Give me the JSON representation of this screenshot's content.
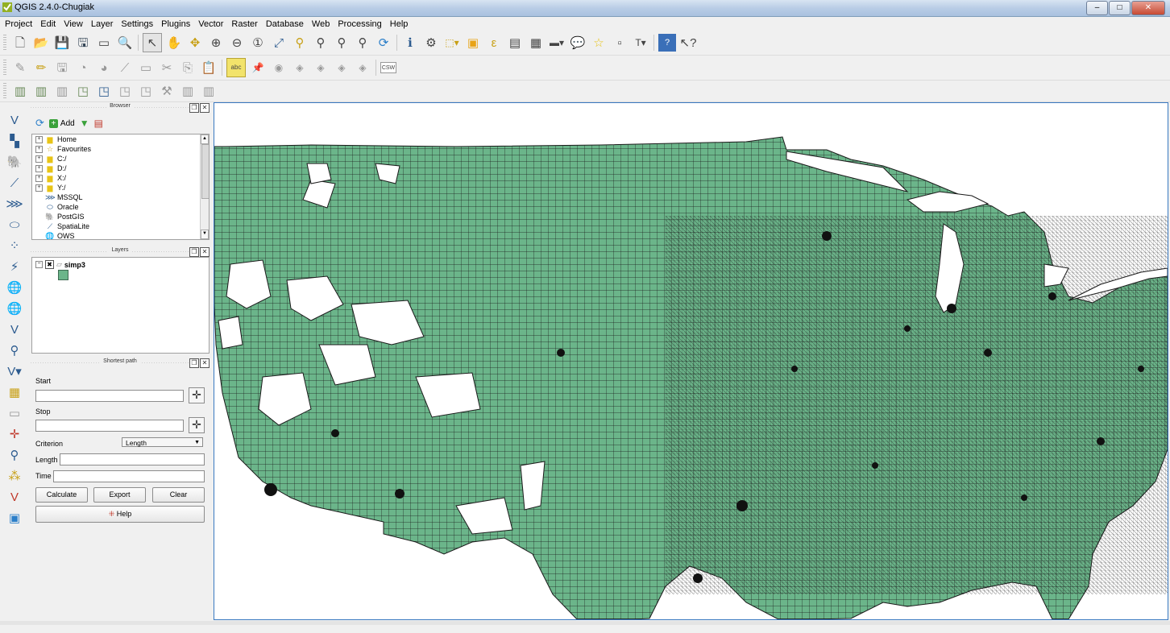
{
  "window": {
    "title": "QGIS 2.4.0-Chugiak"
  },
  "menu": [
    "Project",
    "Edit",
    "View",
    "Layer",
    "Settings",
    "Plugins",
    "Vector",
    "Raster",
    "Database",
    "Web",
    "Processing",
    "Help"
  ],
  "toolbar": {
    "label_abc": "abc",
    "csw": "CSW",
    "help_label": "?"
  },
  "browser": {
    "title": "Browser",
    "add_label": "Add",
    "items": [
      {
        "label": "Home",
        "icon": "folder-icon",
        "expandable": true
      },
      {
        "label": "Favourites",
        "icon": "star-icon",
        "expandable": true
      },
      {
        "label": "C:/",
        "icon": "folder-icon",
        "expandable": true
      },
      {
        "label": "D:/",
        "icon": "folder-icon",
        "expandable": true
      },
      {
        "label": "X:/",
        "icon": "folder-icon",
        "expandable": true
      },
      {
        "label": "Y:/",
        "icon": "folder-icon",
        "expandable": true
      },
      {
        "label": "MSSQL",
        "icon": "mssql-icon",
        "expandable": false
      },
      {
        "label": "Oracle",
        "icon": "oracle-icon",
        "expandable": false
      },
      {
        "label": "PostGIS",
        "icon": "postgis-icon",
        "expandable": false
      },
      {
        "label": "SpatiaLite",
        "icon": "spatialite-icon",
        "expandable": false
      },
      {
        "label": "OWS",
        "icon": "ows-icon",
        "expandable": false
      }
    ]
  },
  "layers": {
    "title": "Layers",
    "layer_name": "simp3",
    "fill_color": "#6bb58a"
  },
  "shortest_path": {
    "title": "Shortest path",
    "start_label": "Start",
    "stop_label": "Stop",
    "criterion_label": "Criterion",
    "criterion_value": "Length",
    "length_label": "Length",
    "time_label": "Time",
    "calculate_label": "Calculate",
    "export_label": "Export",
    "clear_label": "Clear",
    "help_label": "Help"
  },
  "map": {
    "fill_color": "#6bb58a",
    "stroke_color": "#1a1a1a",
    "background": "#ffffff"
  }
}
